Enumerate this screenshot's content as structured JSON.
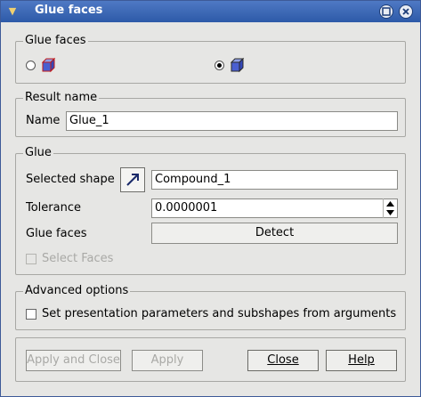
{
  "window": {
    "title": "Glue faces",
    "icons": [
      "pin-icon",
      "minimize-icon",
      "close-icon"
    ]
  },
  "mode_group": {
    "title": "Glue faces",
    "options": [
      {
        "name": "glue-faces-mode",
        "selected": false,
        "icon": "cube-icon"
      },
      {
        "name": "glue-faces-by-selection-mode",
        "selected": true,
        "icon": "cube-icon"
      }
    ]
  },
  "result_group": {
    "title": "Result name",
    "name_label": "Name",
    "name_value": "Glue_1"
  },
  "glue_group": {
    "title": "Glue",
    "selected_shape_label": "Selected shape",
    "selected_shape_value": "Compound_1",
    "tolerance_label": "Tolerance",
    "tolerance_value": "0.0000001",
    "glue_faces_label": "Glue faces",
    "detect_label": "Detect",
    "select_faces_label": "Select Faces",
    "select_faces_checked": false,
    "select_faces_enabled": false
  },
  "advanced_group": {
    "title": "Advanced options",
    "set_params_label": "Set presentation parameters and subshapes from arguments",
    "set_params_checked": false
  },
  "buttons": {
    "apply_and_close": "Apply and Close",
    "apply": "Apply",
    "close": "Close",
    "help": "Help"
  },
  "colors": {
    "titlebar": "#2d5aa8",
    "cube_face": "#4a5fd0",
    "cube_edge": "#c01818"
  }
}
